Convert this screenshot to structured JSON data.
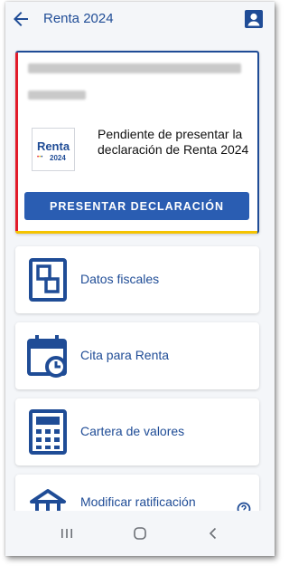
{
  "header": {
    "title": "Renta 2024",
    "back_icon": "arrow-left-icon",
    "profile_icon": "account-box-icon"
  },
  "declaration_card": {
    "logo": {
      "word": "Renta",
      "year": "2024"
    },
    "status_text": "Pendiente de presentar la declaración de Renta 2024",
    "action_label": "PRESENTAR DECLARACIÓN"
  },
  "menu": [
    {
      "label": "Datos fiscales",
      "icon": "fiscal-document-icon"
    },
    {
      "label": "Cita para Renta",
      "icon": "calendar-clock-icon"
    },
    {
      "label": "Cartera de valores",
      "icon": "calculator-icon"
    },
    {
      "label": "Modificar ratificación",
      "icon": "house-icon"
    }
  ],
  "help_icon": "help-circle-icon",
  "system_nav": {
    "recents": "recents-icon",
    "home": "home-circle-icon",
    "back": "chevron-back-icon"
  },
  "colors": {
    "brand_blue": "#1f4c96",
    "button_blue": "#2a5db2",
    "accent_red": "#e21b2a",
    "accent_yellow": "#f5c400",
    "background": "#f4f6f9"
  }
}
